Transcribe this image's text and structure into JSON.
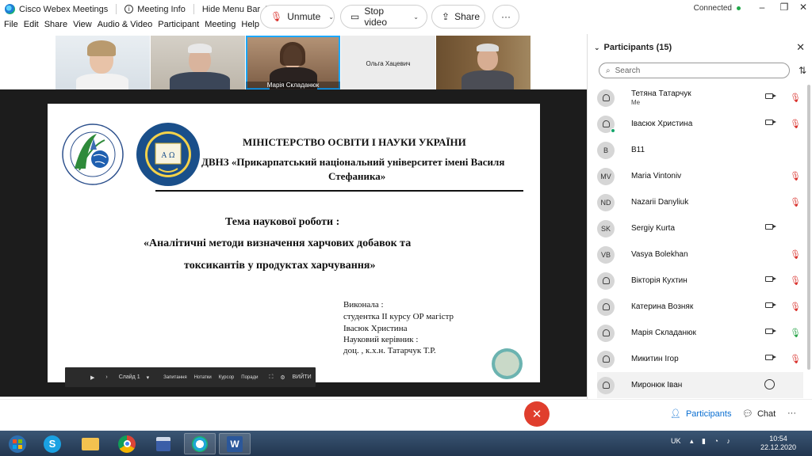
{
  "titlebar": {
    "app_name": "Cisco Webex Meetings",
    "meeting_info": "Meeting Info",
    "hide_menu": "Hide Menu Bar",
    "status": "Connected"
  },
  "menu": [
    "File",
    "Edit",
    "Share",
    "View",
    "Audio & Video",
    "Participant",
    "Meeting",
    "Help"
  ],
  "thumbnails": [
    {
      "name": ""
    },
    {
      "name": ""
    },
    {
      "name": "Марія Складанюк"
    },
    {
      "name": "Ольга Хацевич"
    },
    {
      "name": ""
    }
  ],
  "slide": {
    "ministry": "МІНІСТЕРСТВО ОСВІТИ І НАУКИ УКРАЇНИ",
    "university_line1": "ДВНЗ «Прикарпатський національний університет імені Василя",
    "university_line2": "Стефаника»",
    "topic_label": "Тема наукової роботи  :",
    "topic_line1": "«Аналітичні методи визначення харчових добавок та",
    "topic_line2": "токсикантів у продуктах харчування»",
    "performed": "Виконала :",
    "student": "студентка  ІІ курсу ОР магістр",
    "student_name": "Івасюк Христина",
    "supervisor_label": "Науковий керівник :",
    "supervisor": "доц. , к.х.н. Татарчук Т.Р."
  },
  "slidebar": {
    "slide_label": "Слайд 1",
    "tool1": "Запитання",
    "tool2": "Нотатки",
    "tool3": "Курсор",
    "tool4": "Поради",
    "exit": "ВИЙТИ"
  },
  "panel": {
    "title": "Participants (15)",
    "search_placeholder": "Search",
    "participants": [
      {
        "initials": "",
        "name": "Тетяна Татарчук",
        "sub": "Me",
        "video": true,
        "mic": "muted"
      },
      {
        "initials": "",
        "name": "Івасюк Христина",
        "sub": "",
        "video": true,
        "mic": "muted"
      },
      {
        "initials": "B",
        "name": "B11",
        "sub": "",
        "video": false,
        "mic": "none"
      },
      {
        "initials": "MV",
        "name": "Maria Vintoniv",
        "sub": "",
        "video": false,
        "mic": "muted"
      },
      {
        "initials": "ND",
        "name": "Nazarii Danyliuk",
        "sub": "",
        "video": false,
        "mic": "muted"
      },
      {
        "initials": "SK",
        "name": "Sergiy Kurta",
        "sub": "",
        "video": true,
        "mic": "none"
      },
      {
        "initials": "VB",
        "name": "Vasya Bolekhan",
        "sub": "",
        "video": false,
        "mic": "muted"
      },
      {
        "initials": "",
        "name": "Вікторія Кухтин",
        "sub": "",
        "video": true,
        "mic": "muted"
      },
      {
        "initials": "",
        "name": "Катерина Возняк",
        "sub": "",
        "video": true,
        "mic": "muted"
      },
      {
        "initials": "",
        "name": "Марія Складанюк",
        "sub": "",
        "video": true,
        "mic": "on"
      },
      {
        "initials": "",
        "name": "Микитин Ігор",
        "sub": "",
        "video": true,
        "mic": "muted"
      },
      {
        "initials": "",
        "name": "Миронюк Іван",
        "sub": "",
        "video": false,
        "mic": "chat"
      }
    ]
  },
  "controls": {
    "unmute": "Unmute",
    "stop_video": "Stop video",
    "share": "Share",
    "more": "···",
    "participants": "Participants",
    "chat": "Chat"
  },
  "taskbar": {
    "lang": "UK",
    "time": "10:54",
    "date": "22.12.2020"
  },
  "colors": {
    "accent": "#0a6ed1",
    "end_call": "#e03e2d",
    "muted": "#d9302b",
    "active_speaker": "#1ba8ff"
  }
}
